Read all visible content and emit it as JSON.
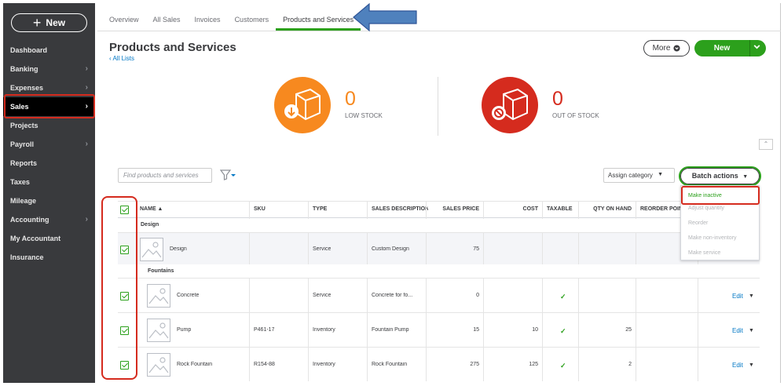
{
  "sidebar": {
    "new_label": "New",
    "items": [
      {
        "label": "Dashboard",
        "chevron": false
      },
      {
        "label": "Banking",
        "chevron": true
      },
      {
        "label": "Expenses",
        "chevron": true
      },
      {
        "label": "Sales",
        "chevron": true,
        "active": true
      },
      {
        "label": "Projects",
        "chevron": false
      },
      {
        "label": "Payroll",
        "chevron": true
      },
      {
        "label": "Reports",
        "chevron": false
      },
      {
        "label": "Taxes",
        "chevron": false
      },
      {
        "label": "Mileage",
        "chevron": false
      },
      {
        "label": "Accounting",
        "chevron": true
      },
      {
        "label": "My Accountant",
        "chevron": false
      },
      {
        "label": "Insurance",
        "chevron": false
      }
    ]
  },
  "tabs": [
    "Overview",
    "All Sales",
    "Invoices",
    "Customers",
    "Products and Services"
  ],
  "active_tab": "Products and Services",
  "page": {
    "title": "Products and Services",
    "back_link": "All Lists",
    "more_label": "More",
    "new_label": "New"
  },
  "stock": {
    "low": {
      "count": "0",
      "label": "LOW STOCK"
    },
    "out": {
      "count": "0",
      "label": "OUT OF STOCK"
    }
  },
  "toolbar": {
    "search_placeholder": "Find products and services",
    "assign_category": "Assign category",
    "batch_actions": "Batch actions"
  },
  "batch_menu": [
    "Make inactive",
    "Adjust quantity",
    "Reorder",
    "Make non-inventory",
    "Make service"
  ],
  "table": {
    "columns": [
      "NAME ▲",
      "SKU",
      "TYPE",
      "SALES DESCRIPTION",
      "SALES PRICE",
      "COST",
      "TAXABLE",
      "QTY ON HAND",
      "REORDER POINT"
    ],
    "groups": [
      {
        "name": "Design",
        "rows": [
          {
            "name": "Design",
            "sku": "",
            "type": "Service",
            "desc": "Custom Design",
            "price": "75",
            "cost": "",
            "taxable": false,
            "qty": "",
            "edit": ""
          }
        ]
      },
      {
        "name": "Fountains",
        "rows": [
          {
            "name": "Concrete",
            "sku": "",
            "type": "Service",
            "desc": "Concrete for fo...",
            "price": "0",
            "cost": "",
            "taxable": true,
            "qty": "",
            "edit": "Edit"
          },
          {
            "name": "Pump",
            "sku": "P461-17",
            "type": "Inventory",
            "desc": "Fountain Pump",
            "price": "15",
            "cost": "10",
            "taxable": true,
            "qty": "25",
            "edit": "Edit"
          },
          {
            "name": "Rock Fountain",
            "sku": "R154-88",
            "type": "Inventory",
            "desc": "Rock Fountain",
            "price": "275",
            "cost": "125",
            "taxable": true,
            "qty": "2",
            "edit": "Edit"
          }
        ]
      }
    ]
  },
  "colors": {
    "green": "#2ca01c",
    "orange": "#f7891f",
    "red": "#d52b1e",
    "sidebar": "#393a3d",
    "link": "#0077c5",
    "arrow": "#4f81bd"
  }
}
